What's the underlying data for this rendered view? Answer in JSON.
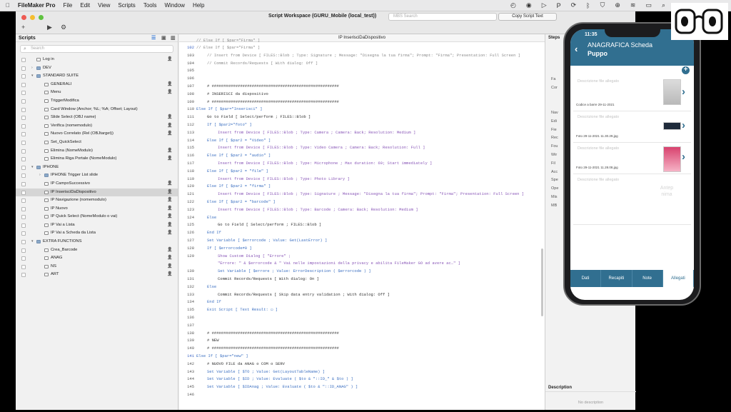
{
  "menubar": {
    "app": "FileMaker Pro",
    "items": [
      "File",
      "Edit",
      "View",
      "Scripts",
      "Tools",
      "Window",
      "Help"
    ],
    "status_icons": [
      "time-machine-icon",
      "stop-icon",
      "playback-icon",
      "paypal-icon",
      "sync-icon",
      "bluetooth-icon",
      "shield-icon",
      "globe-icon",
      "wifi-icon",
      "battery-icon",
      "search-icon"
    ]
  },
  "window": {
    "title": "Script Workspace (GURU_Mobile (local_test))",
    "search_placeholder": "MBS Search",
    "copy_button": "Copy Script Text"
  },
  "toolbar": {
    "add": "+",
    "run": "▶",
    "debug": "⚙"
  },
  "scripts_panel": {
    "title": "Scripts",
    "search_placeholder": "Search",
    "items": [
      {
        "level": 0,
        "name": "Log in",
        "kind": "script",
        "user": true
      },
      {
        "level": 0,
        "name": "DEV",
        "kind": "folder",
        "state": "collapsed"
      },
      {
        "level": 0,
        "name": "STANDARD SUITE",
        "kind": "folder",
        "state": "expanded"
      },
      {
        "level": 1,
        "name": "GENERALI",
        "kind": "script",
        "user": true
      },
      {
        "level": 1,
        "name": "Menu",
        "kind": "script",
        "user": true
      },
      {
        "level": 1,
        "name": "TriggerModifica",
        "kind": "script",
        "user": false
      },
      {
        "level": 1,
        "name": "Card Window (Anchor; %L; %A; Offset; Layout)",
        "kind": "script",
        "user": false
      },
      {
        "level": 1,
        "name": "Slide Select (OBJ name)",
        "kind": "script",
        "user": true
      },
      {
        "level": 1,
        "name": "Verifica (nomemodulo)",
        "kind": "script",
        "user": true
      },
      {
        "level": 1,
        "name": "Nuovo Correlato (Rel (OBJtarget))",
        "kind": "script",
        "user": true
      },
      {
        "level": 1,
        "name": "Set_QuickSelect",
        "kind": "script",
        "user": false
      },
      {
        "level": 1,
        "name": "Elimina (NomeModulo)",
        "kind": "script",
        "user": true
      },
      {
        "level": 1,
        "name": "Elimina Riga Portale (NomeModulo)",
        "kind": "script",
        "user": true
      },
      {
        "level": 0,
        "name": "IPHONE",
        "kind": "folder",
        "state": "expanded"
      },
      {
        "level": 1,
        "name": "IPHONE Trigger List slide",
        "kind": "folder",
        "state": "collapsed"
      },
      {
        "level": 1,
        "name": "IP CampoSuccessivo",
        "kind": "script",
        "user": true
      },
      {
        "level": 1,
        "name": "IP InserisciDaDispositivo",
        "kind": "script",
        "user": true,
        "selected": true
      },
      {
        "level": 1,
        "name": "IP Navigazione (nomemodulo)",
        "kind": "script",
        "user": true
      },
      {
        "level": 1,
        "name": "IP Nuovo",
        "kind": "script",
        "user": true
      },
      {
        "level": 1,
        "name": "IP Quick Select (NomeModulo o vai)",
        "kind": "script",
        "user": true
      },
      {
        "level": 1,
        "name": "IP Vai a Lista",
        "kind": "script",
        "user": true
      },
      {
        "level": 1,
        "name": "IP Vai a Scheda da Lista",
        "kind": "script",
        "user": true
      },
      {
        "level": 0,
        "name": "EXTRA FUNCTIONS",
        "kind": "folder",
        "state": "expanded"
      },
      {
        "level": 1,
        "name": "Crea_Barcode",
        "kind": "script",
        "user": true
      },
      {
        "level": 1,
        "name": "ANAG",
        "kind": "script",
        "user": true
      },
      {
        "level": 1,
        "name": "NS",
        "kind": "script",
        "user": true
      },
      {
        "level": 1,
        "name": "ART",
        "kind": "script",
        "user": true
      }
    ]
  },
  "editor": {
    "tab_title": "IP InserisciDaDispositivo",
    "lines": [
      {
        "n": "",
        "ind": 0,
        "c": 2,
        "t": "// Else If [ $par=\"Firma\" ]"
      },
      {
        "n": "102",
        "ind": 0,
        "c": 2,
        "t": "// Else If [ $par=\"Firma\" ]",
        "bp": true
      },
      {
        "n": "103",
        "ind": 1,
        "c": 2,
        "t": "// Insert from Device [ FILES::Blob ; Type: Signature ; Message: \"Disegna la tua firma\"; Prompt: \"Firma\"; Presentation: Full Screen ]"
      },
      {
        "n": "104",
        "ind": 1,
        "c": 2,
        "t": "// Commit Records/Requests [ With dialog: Off ]"
      },
      {
        "n": "105",
        "ind": 0,
        "c": 0,
        "t": ""
      },
      {
        "n": "106",
        "ind": 0,
        "c": 0,
        "t": ""
      },
      {
        "n": "107",
        "ind": 1,
        "c": 0,
        "t": "# ######################################################"
      },
      {
        "n": "108",
        "ind": 1,
        "c": 0,
        "t": "# INSERISCI da dispositivo"
      },
      {
        "n": "109",
        "ind": 1,
        "c": 0,
        "t": "# ######################################################"
      },
      {
        "n": "110",
        "ind": 0,
        "c": 3,
        "t": "Else If [ $par=\"Inserisci\" ]"
      },
      {
        "n": "111",
        "ind": 1,
        "c": 0,
        "t": "Go to Field [ Select/perform ; FILES::Blob ]"
      },
      {
        "n": "112",
        "ind": 1,
        "c": 3,
        "t": "If [ $par2=\"foto\" ]"
      },
      {
        "n": "113",
        "ind": 2,
        "c": 1,
        "t": "Insert from Device [ FILES::Blob ; Type: Camera ; Camera: Back; Resolution: Medium ]"
      },
      {
        "n": "114",
        "ind": 1,
        "c": 3,
        "t": "Else If [ $par2 = \"Video\" ]"
      },
      {
        "n": "115",
        "ind": 2,
        "c": 1,
        "t": "Insert from Device [ FILES::Blob ; Type: Video Camera ; Camera: Back; Resolution: Full ]"
      },
      {
        "n": "116",
        "ind": 1,
        "c": 3,
        "t": "Else If [ $par2 = \"audio\" ]"
      },
      {
        "n": "117",
        "ind": 2,
        "c": 1,
        "t": "Insert from Device [ FILES::Blob ; Type: Microphone ; Max duration: 60; Start immediately ]"
      },
      {
        "n": "118",
        "ind": 1,
        "c": 3,
        "t": "Else If [ $par2 = \"file\" ]"
      },
      {
        "n": "119",
        "ind": 2,
        "c": 1,
        "t": "Insert from Device [ FILES::Blob ; Type: Photo Library ]"
      },
      {
        "n": "120",
        "ind": 1,
        "c": 3,
        "t": "Else If [ $par2 = \"firma\" ]"
      },
      {
        "n": "121",
        "ind": 2,
        "c": 1,
        "t": "Insert from Device [ FILES::Blob ; Type: Signature ; Message: \"Disegna la tua firma\"; Prompt: \"Firma\"; Presentation: Full Screen ]"
      },
      {
        "n": "122",
        "ind": 1,
        "c": 3,
        "t": "Else If [ $par2 = \"barcode\" ]"
      },
      {
        "n": "123",
        "ind": 2,
        "c": 1,
        "t": "Insert from Device [ FILES::Blob ; Type: Barcode ; Camera: Back; Resolution: Medium ]"
      },
      {
        "n": "124",
        "ind": 1,
        "c": 3,
        "t": "Else"
      },
      {
        "n": "125",
        "ind": 2,
        "c": 0,
        "t": "Go to Field [ Select/perform ; FILES::Blob ]"
      },
      {
        "n": "126",
        "ind": 1,
        "c": 3,
        "t": "End If"
      },
      {
        "n": "127",
        "ind": 1,
        "c": 3,
        "t": "Set Variable [ $errorcode ; Value: Get(LastError) ]"
      },
      {
        "n": "128",
        "ind": 1,
        "c": 3,
        "t": "If [ $errorcode≠0 ]"
      },
      {
        "n": "129",
        "ind": 2,
        "c": 1,
        "t": "Show Custom Dialog [ \"Errore\" ;"
      },
      {
        "n": "",
        "ind": 2,
        "c": 1,
        "t": "\"Errore: \" & $errorcode & \" Vai nelle impostazioni della privacy e abilita FileMaker GO ad avere ac…\" ]"
      },
      {
        "n": "130",
        "ind": 2,
        "c": 3,
        "t": "Set Variable [ $errore ; Value: ErrorDescription ( $errorcode ) ]"
      },
      {
        "n": "131",
        "ind": 2,
        "c": 0,
        "t": "Commit Records/Requests [ With dialog: On ]"
      },
      {
        "n": "132",
        "ind": 1,
        "c": 3,
        "t": "Else"
      },
      {
        "n": "133",
        "ind": 2,
        "c": 0,
        "t": "Commit Records/Requests [ Skip data entry validation ; With dialog: Off ]"
      },
      {
        "n": "134",
        "ind": 1,
        "c": 3,
        "t": "End If"
      },
      {
        "n": "135",
        "ind": 1,
        "c": 3,
        "t": "Exit Script [ Text Result: ▭ ]"
      },
      {
        "n": "136",
        "ind": 0,
        "c": 0,
        "t": ""
      },
      {
        "n": "137",
        "ind": 0,
        "c": 0,
        "t": ""
      },
      {
        "n": "138",
        "ind": 1,
        "c": 0,
        "t": "# ######################################################"
      },
      {
        "n": "139",
        "ind": 1,
        "c": 0,
        "t": "# NEW"
      },
      {
        "n": "140",
        "ind": 1,
        "c": 0,
        "t": "# ######################################################"
      },
      {
        "n": "141",
        "ind": 0,
        "c": 3,
        "t": "Else If [ $par=\"new\" ]",
        "bp": true
      },
      {
        "n": "142",
        "ind": 1,
        "c": 0,
        "t": "# NUOVO FILE da ANAG o COM o SERV"
      },
      {
        "n": "143",
        "ind": 1,
        "c": 3,
        "t": "Set Variable [ $TO ; Value: Get(LayoutTableName) ]"
      },
      {
        "n": "144",
        "ind": 1,
        "c": 3,
        "t": "Set Variable [ $ID ; Value: Evaluate ( $to & \"::ID_\" & $to ) ]"
      },
      {
        "n": "145",
        "ind": 1,
        "c": 3,
        "t": "Set Variable [ $IDAnag ; Value: Evaluate ( $to & \"::ID_ANAG\" ) ]"
      },
      {
        "n": "146",
        "ind": 0,
        "c": 0,
        "t": ""
      }
    ]
  },
  "steps_panel": {
    "title": "Steps",
    "items": [
      "Fa",
      "Cor",
      "Nav",
      "Edi",
      "Fie",
      "Rec",
      "Fou",
      "Wir",
      "Fil",
      "Acc",
      "Spe",
      "Ope",
      "Mis",
      "MB"
    ],
    "description_title": "Description",
    "description_body": "No description"
  },
  "phone": {
    "time": "11:35",
    "header_title": "ANAGRAFICA Scheda",
    "header_name": "Puppo",
    "placeholder": "Descrizione file allegato",
    "cards": [
      {
        "caption": "Codice a barre 29-11-2021",
        "img": "photo"
      },
      {
        "caption": "Foto 29-11-2021 11.30.29.jpg",
        "img": "screen"
      },
      {
        "caption": "Foto 29-11-2021 11.28.08.jpg",
        "img": "pink"
      },
      {
        "caption": "",
        "img": "none",
        "preview": "Antep nima"
      }
    ],
    "tabs": [
      "Dati",
      "Recapiti",
      "Note",
      "Allegati"
    ],
    "active_tab": "Allegati"
  },
  "colors": {
    "accent": "#316f90",
    "keyword_blue": "#3b6fc1",
    "step_purple": "#8a58b8",
    "comment_grey": "#8b8b8b"
  }
}
